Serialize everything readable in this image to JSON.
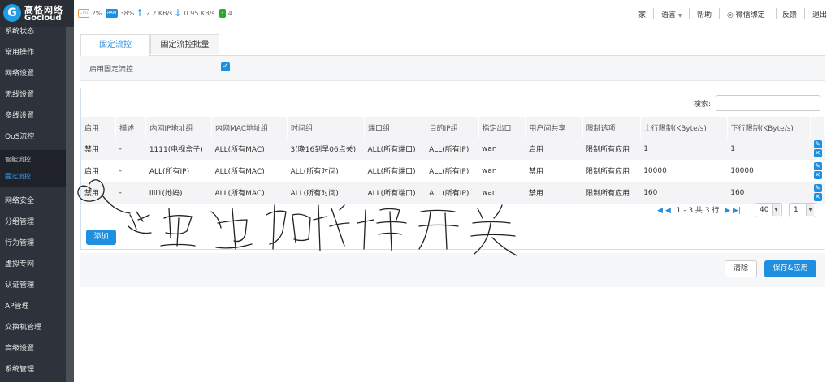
{
  "brand": {
    "cn": "高恪网络",
    "en": "Gocloud"
  },
  "stats": {
    "cpu_chip": "CPU",
    "cpu": "2%",
    "ram_chip": "RAM",
    "ram": "38%",
    "up": "2.2 KB/s",
    "down": "0.95 KB/s",
    "online": "4"
  },
  "toplinks": {
    "home": "家",
    "language": "语言",
    "help": "帮助",
    "wechat": "微信绑定",
    "feedback": "反馈",
    "logout": "退出"
  },
  "sidebar": {
    "items": [
      "系统状态",
      "常用操作",
      "网络设置",
      "无线设置",
      "多线设置",
      "QoS流控"
    ],
    "sub": [
      "智能流控",
      "固定流控"
    ],
    "items2": [
      "网络安全",
      "分组管理",
      "行为管理",
      "虚拟专网",
      "认证管理",
      "AP管理",
      "交换机管理",
      "高级设置",
      "系统管理"
    ]
  },
  "tabs": [
    "固定流控",
    "固定流控批量"
  ],
  "enable_label": "启用固定流控",
  "search_label": "搜索:",
  "table": {
    "headers": [
      "启用",
      "描述",
      "内网IP地址组",
      "内网MAC地址组",
      "时间组",
      "端口组",
      "目的IP组",
      "指定出口",
      "用户间共享",
      "限制选项",
      "上行限制(KByte/s)",
      "下行限制(KByte/s)",
      ""
    ],
    "rows": [
      [
        "禁用",
        "-",
        "1111(电视盒子)",
        "ALL(所有MAC)",
        "3(晚16到早06点关)",
        "ALL(所有端口)",
        "ALL(所有IP)",
        "wan",
        "启用",
        "限制所有应用",
        "1",
        "1"
      ],
      [
        "启用",
        "-",
        "ALL(所有IP)",
        "ALL(所有MAC)",
        "ALL(所有时间)",
        "ALL(所有端口)",
        "ALL(所有IP)",
        "wan",
        "禁用",
        "限制所有应用",
        "10000",
        "10000"
      ],
      [
        "禁用",
        "-",
        "iiii1(她妈)",
        "ALL(所有MAC)",
        "ALL(所有时间)",
        "ALL(所有端口)",
        "ALL(所有IP)",
        "wan",
        "禁用",
        "限制所有应用",
        "160",
        "160"
      ]
    ]
  },
  "pager": {
    "info": "1 - 3 共 3 行",
    "page_size": "40",
    "page": "1"
  },
  "buttons": {
    "add": "添加",
    "clear": "清除",
    "save": "保存&应用"
  },
  "annotation": {
    "handwritten": "这里也加快捷开关"
  },
  "colors": {
    "accent": "#1f8fe0",
    "sidebar": "#2e323a"
  }
}
